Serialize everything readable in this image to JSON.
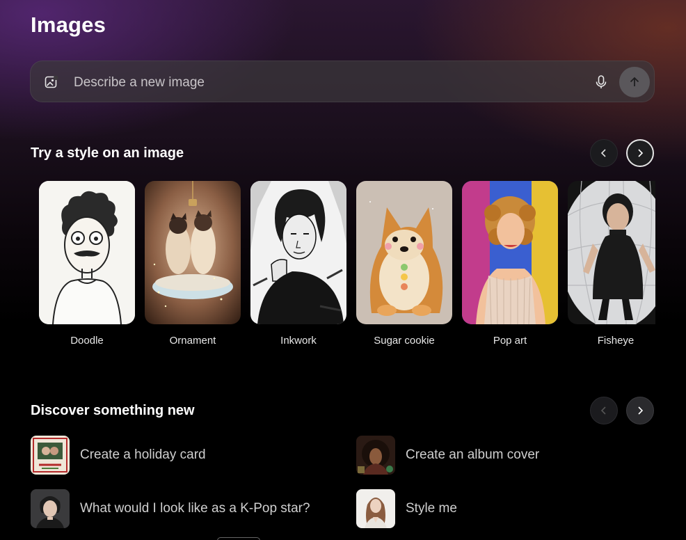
{
  "page": {
    "title": "Images"
  },
  "search": {
    "placeholder": "Describe a new image",
    "image_icon": "image-add-icon",
    "mic_icon": "microphone-icon",
    "send_icon": "arrow-up-icon"
  },
  "styles": {
    "title": "Try a style on an image",
    "items": [
      {
        "label": "Doodle"
      },
      {
        "label": "Ornament"
      },
      {
        "label": "Inkwork"
      },
      {
        "label": "Sugar cookie"
      },
      {
        "label": "Pop art"
      },
      {
        "label": "Fisheye"
      }
    ],
    "prev_icon": "chevron-left-icon",
    "next_icon": "chevron-right-icon"
  },
  "discover": {
    "title": "Discover something new",
    "items": [
      {
        "label": "Create a holiday card"
      },
      {
        "label": "Create an album cover"
      },
      {
        "label": "What would I look like as a K-Pop star?"
      },
      {
        "label": "Style me"
      }
    ],
    "prev_icon": "chevron-left-icon",
    "next_icon": "chevron-right-icon"
  },
  "colors": {
    "background": "#000000",
    "search_bg": "#3c383c",
    "send_button": "#5a575b"
  }
}
